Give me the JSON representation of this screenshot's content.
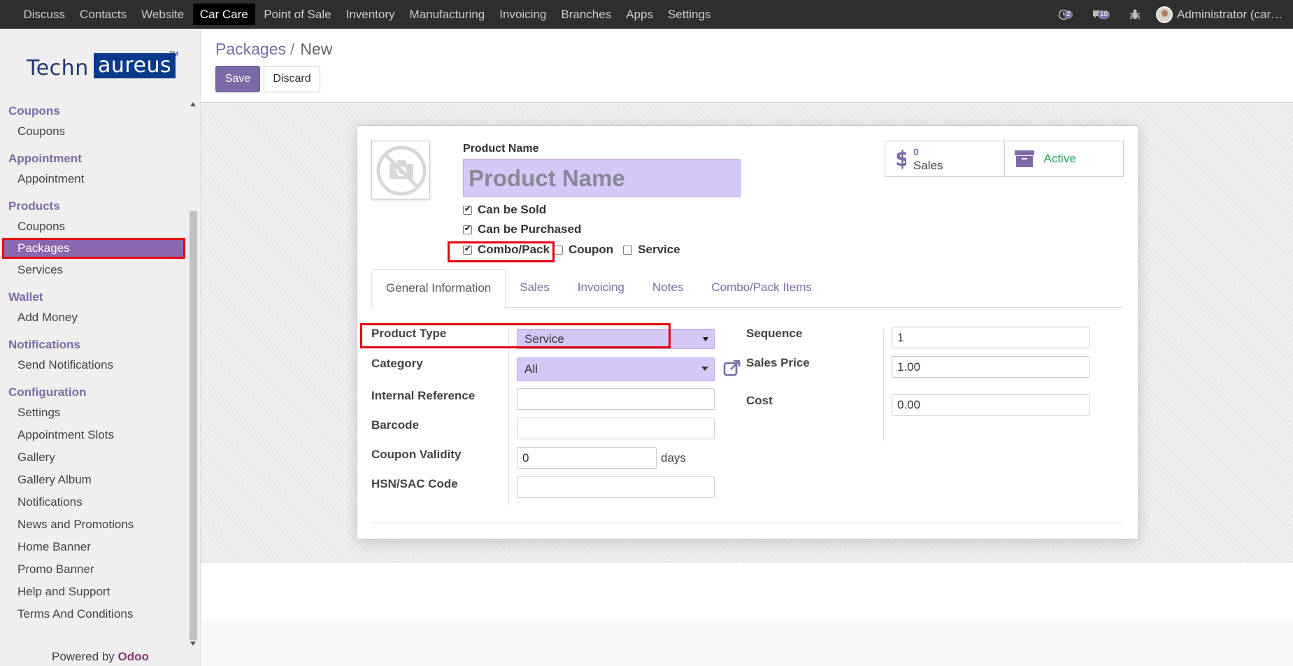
{
  "topbar": {
    "menu": [
      "Discuss",
      "Contacts",
      "Website",
      "Car Care",
      "Point of Sale",
      "Inventory",
      "Manufacturing",
      "Invoicing",
      "Branches",
      "Apps",
      "Settings"
    ],
    "active_menu": "Car Care",
    "activity_count": "2",
    "messages_count": "10",
    "user": "Administrator (car_care..."
  },
  "sidebar": {
    "logo_left": "Techn",
    "logo_right": "aureus",
    "logo_tm": "TM",
    "groups": [
      {
        "title": "Coupons",
        "items": [
          "Coupons"
        ]
      },
      {
        "title": "Appointment",
        "items": [
          "Appointment"
        ]
      },
      {
        "title": "Products",
        "items": [
          "Coupons",
          "Packages",
          "Services"
        ]
      },
      {
        "title": "Wallet",
        "items": [
          "Add Money"
        ]
      },
      {
        "title": "Notifications",
        "items": [
          "Send Notifications"
        ]
      },
      {
        "title": "Configuration",
        "items": [
          "Settings",
          "Appointment Slots",
          "Gallery",
          "Gallery Album",
          "Notifications",
          "News and Promotions",
          "Home Banner",
          "Promo Banner",
          "Help and Support",
          "Terms And Conditions"
        ]
      }
    ],
    "active_item": "Packages",
    "powered_by": "Powered by",
    "powered_brand": "Odoo"
  },
  "control": {
    "breadcrumb_parent": "Packages",
    "breadcrumb_sep": "/",
    "breadcrumb_current": "New",
    "save_label": "Save",
    "discard_label": "Discard"
  },
  "form": {
    "product_name_label": "Product Name",
    "product_name_placeholder": "Product Name",
    "can_be_sold": "Can be Sold",
    "can_be_purchased": "Can be Purchased",
    "combo_pack": "Combo/Pack",
    "coupon": "Coupon",
    "service": "Service",
    "stat_sales_count": "0",
    "stat_sales_label": "Sales",
    "stat_active_label": "Active",
    "tabs": [
      "General Information",
      "Sales",
      "Invoicing",
      "Notes",
      "Combo/Pack Items"
    ],
    "active_tab": "General Information",
    "product_type_label": "Product Type",
    "product_type_value": "Service",
    "category_label": "Category",
    "category_value": "All",
    "internal_ref_label": "Internal Reference",
    "barcode_label": "Barcode",
    "coupon_validity_label": "Coupon Validity",
    "coupon_validity_value": "0",
    "days_label": "days",
    "hsn_label": "HSN/SAC Code",
    "sequence_label": "Sequence",
    "sequence_value": "1",
    "sales_price_label": "Sales Price",
    "sales_price_value": "1.00",
    "cost_label": "Cost",
    "cost_value": "0.00"
  },
  "colors": {
    "accent": "#7c6aa8",
    "highlight": "#e8000c",
    "active_green": "#27a15a",
    "required_bg": "#d6c8f6"
  }
}
